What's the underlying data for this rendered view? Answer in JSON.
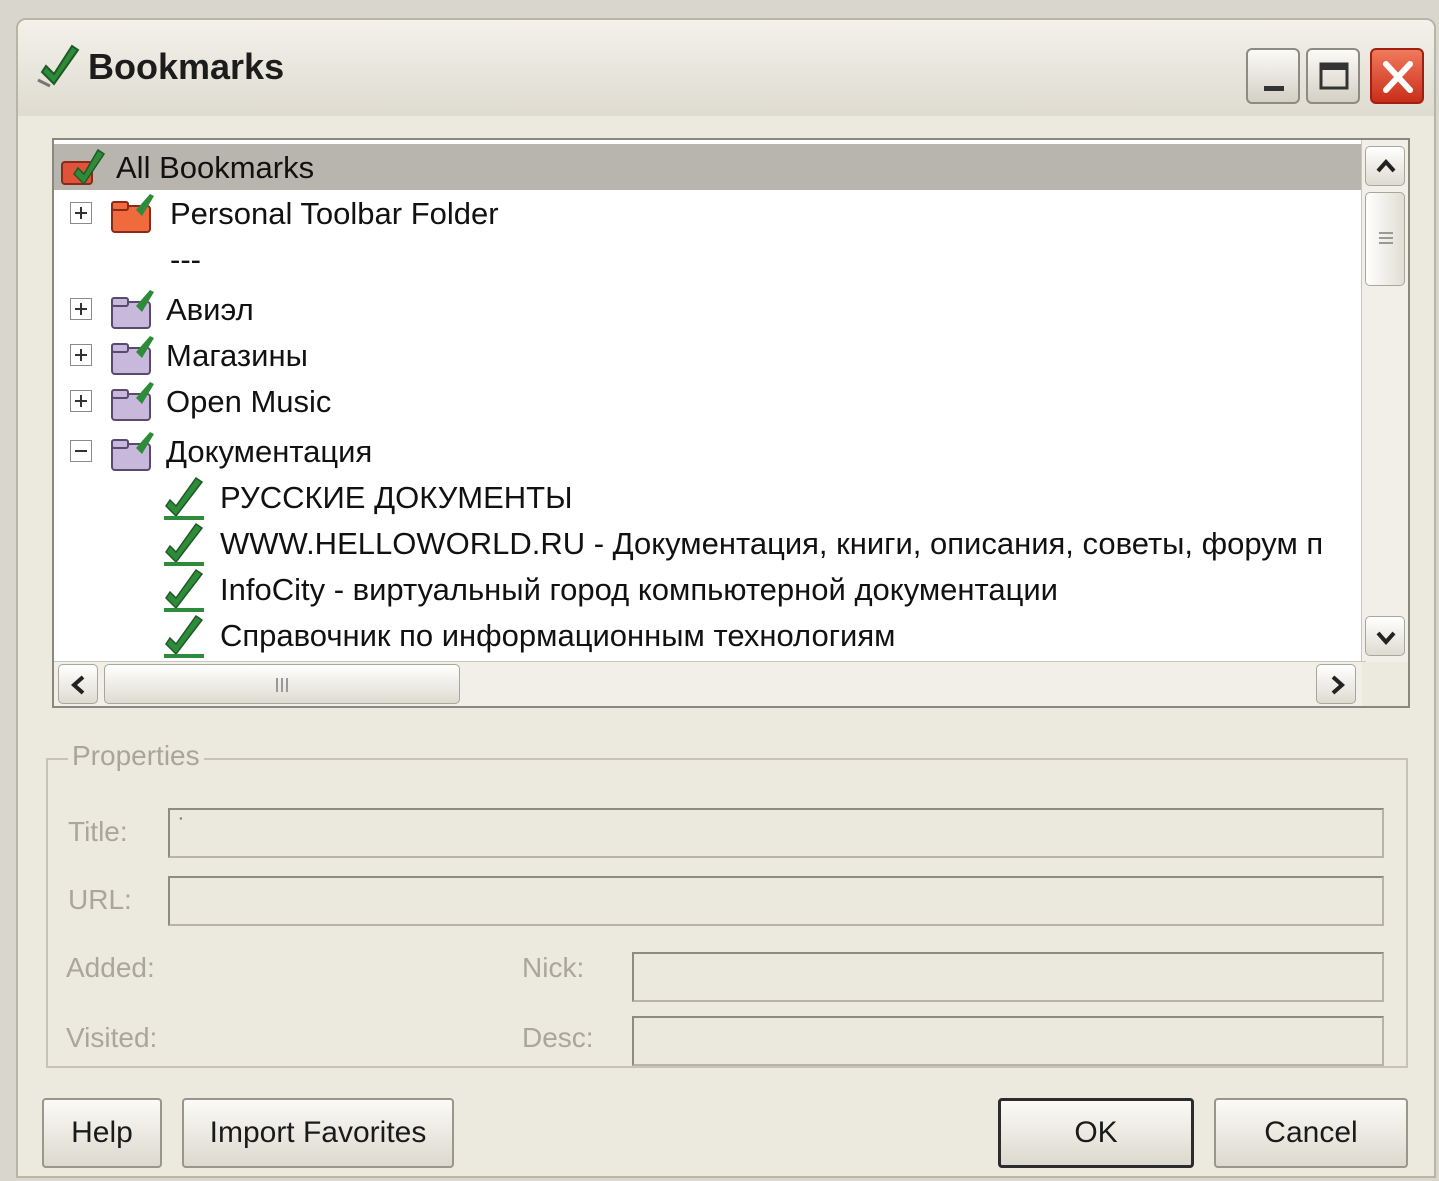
{
  "window": {
    "title": "Bookmarks"
  },
  "tree": {
    "rows": [
      {
        "label": "All Bookmarks",
        "icon": "bookmarks-root-icon",
        "selected": true
      },
      {
        "label": "Personal Toolbar Folder",
        "icon": "toolbar-folder-icon",
        "expander": "plus"
      },
      {
        "label": "---",
        "icon": "separator"
      },
      {
        "label": "Авиэл",
        "icon": "folder-icon",
        "expander": "plus"
      },
      {
        "label": "Магазины",
        "icon": "folder-icon",
        "expander": "plus"
      },
      {
        "label": "Open Music",
        "icon": "folder-icon",
        "expander": "plus"
      },
      {
        "label": "Документация",
        "icon": "folder-icon",
        "expander": "minus"
      },
      {
        "label": "РУССКИЕ ДОКУМЕНТЫ",
        "icon": "bookmark-icon"
      },
      {
        "label": "WWW.HELLOWORLD.RU - Документация, книги, описания, советы, форум п",
        "icon": "bookmark-icon"
      },
      {
        "label": "InfoCity - виртуальный город компьютерной документации",
        "icon": "bookmark-icon"
      },
      {
        "label": "Справочник по информационным технологиям",
        "icon": "bookmark-icon"
      }
    ]
  },
  "properties": {
    "group_label": "Properties",
    "title_label": "Title:",
    "title_value": "˙",
    "url_label": "URL:",
    "url_value": "",
    "added_label": "Added:",
    "visited_label": "Visited:",
    "nick_label": "Nick:",
    "nick_value": "",
    "desc_label": "Desc:",
    "desc_value": ""
  },
  "buttons": {
    "help": "Help",
    "import": "Import Favorites",
    "ok": "OK",
    "cancel": "Cancel"
  },
  "colors": {
    "window_bg": "#ece9df",
    "selection": "#b8b5ae",
    "close_button": "#c92e1a",
    "folder": "#c7b8dc",
    "bookmark_pen": "#2e8b3a"
  }
}
